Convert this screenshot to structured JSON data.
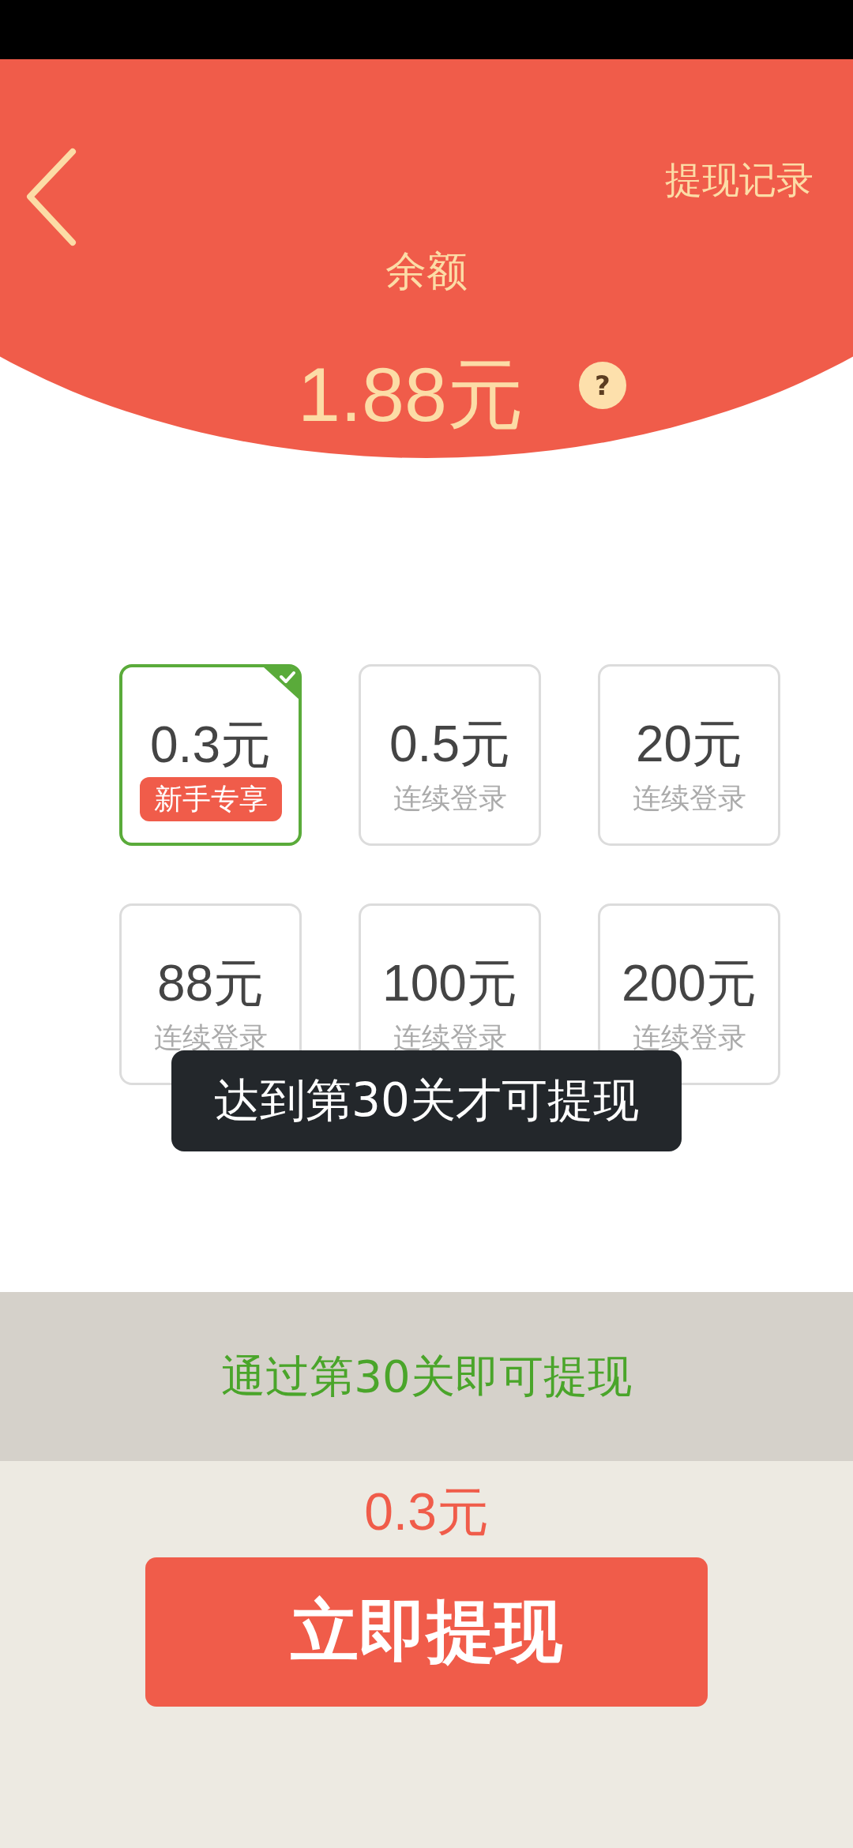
{
  "header": {
    "record_link": "提现记录",
    "balance_label": "余额",
    "balance": "1.88元",
    "help": "?"
  },
  "options": [
    {
      "amount": "0.3元",
      "kind": "badge",
      "tag": "新手专享",
      "selected": true
    },
    {
      "amount": "0.5元",
      "kind": "note",
      "tag": "连续登录",
      "selected": false
    },
    {
      "amount": "20元",
      "kind": "note",
      "tag": "连续登录",
      "selected": false
    },
    {
      "amount": "88元",
      "kind": "note",
      "tag": "连续登录",
      "selected": false
    },
    {
      "amount": "100元",
      "kind": "note",
      "tag": "连续登录",
      "selected": false
    },
    {
      "amount": "200元",
      "kind": "note",
      "tag": "连续登录",
      "selected": false
    }
  ],
  "toast": "达到第30关才可提现",
  "notice": "通过第30关即可提现",
  "selected_amount": "0.3元",
  "withdraw_button": "立即提现"
}
